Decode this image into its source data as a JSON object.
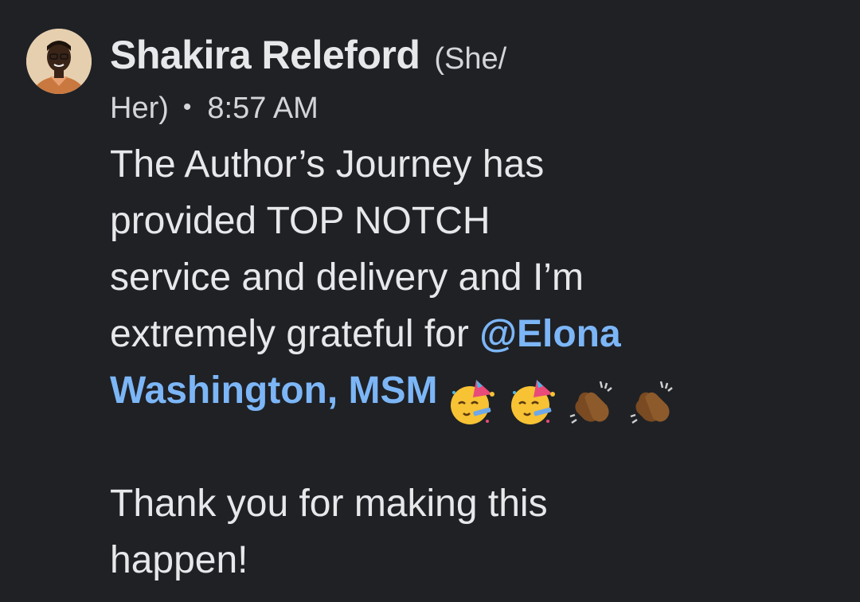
{
  "message": {
    "author": {
      "name": "Shakira Releford",
      "pronouns_part1": "(She/",
      "pronouns_part2": "Her)"
    },
    "separator": "•",
    "timestamp": "8:57 AM",
    "body": {
      "line1": "The Author’s Journey has",
      "line2": "provided TOP NOTCH",
      "line3": "service and delivery and I’m",
      "line4_text": "extremely grateful for ",
      "mention_part1": "@Elona",
      "mention_part2": "Washington, MSM",
      "line6": "Thank you for making this",
      "line7": "happen!"
    },
    "emojis": [
      "partying-face-emoji",
      "partying-face-emoji",
      "clapping-hands-emoji",
      "clapping-hands-emoji"
    ]
  }
}
